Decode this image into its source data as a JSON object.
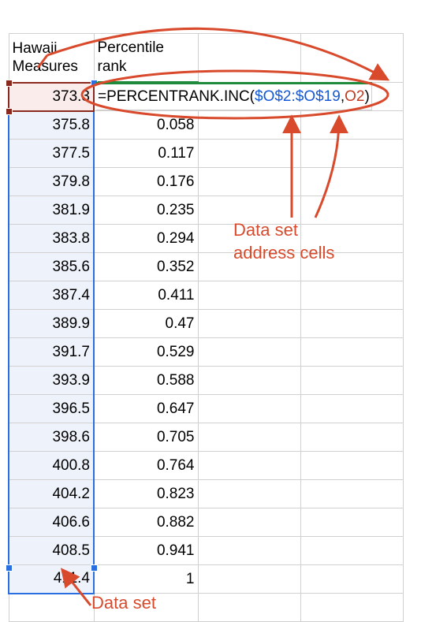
{
  "headers": {
    "colA": "Hawaii\nMeasures",
    "colB": "Percentile\nrank"
  },
  "rows": [
    {
      "measure": "373.3",
      "rank": ""
    },
    {
      "measure": "375.8",
      "rank": "0.058"
    },
    {
      "measure": "377.5",
      "rank": "0.117"
    },
    {
      "measure": "379.8",
      "rank": "0.176"
    },
    {
      "measure": "381.9",
      "rank": "0.235"
    },
    {
      "measure": "383.8",
      "rank": "0.294"
    },
    {
      "measure": "385.6",
      "rank": "0.352"
    },
    {
      "measure": "387.4",
      "rank": "0.411"
    },
    {
      "measure": "389.9",
      "rank": "0.47"
    },
    {
      "measure": "391.7",
      "rank": "0.529"
    },
    {
      "measure": "393.9",
      "rank": "0.588"
    },
    {
      "measure": "396.5",
      "rank": "0.647"
    },
    {
      "measure": "398.6",
      "rank": "0.705"
    },
    {
      "measure": "400.8",
      "rank": "0.764"
    },
    {
      "measure": "404.2",
      "rank": "0.823"
    },
    {
      "measure": "406.6",
      "rank": "0.882"
    },
    {
      "measure": "408.5",
      "rank": "0.941"
    },
    {
      "measure": "411.4",
      "rank": "1"
    }
  ],
  "formula": {
    "prefix": "=PERCENTRANK.INC(",
    "range": "$O$2:$O$19",
    "sep": ",",
    "cell": "O2",
    "suffix": ")"
  },
  "annotations": {
    "dataSet": "Data set",
    "addressCells": "Data set\naddress cells"
  }
}
